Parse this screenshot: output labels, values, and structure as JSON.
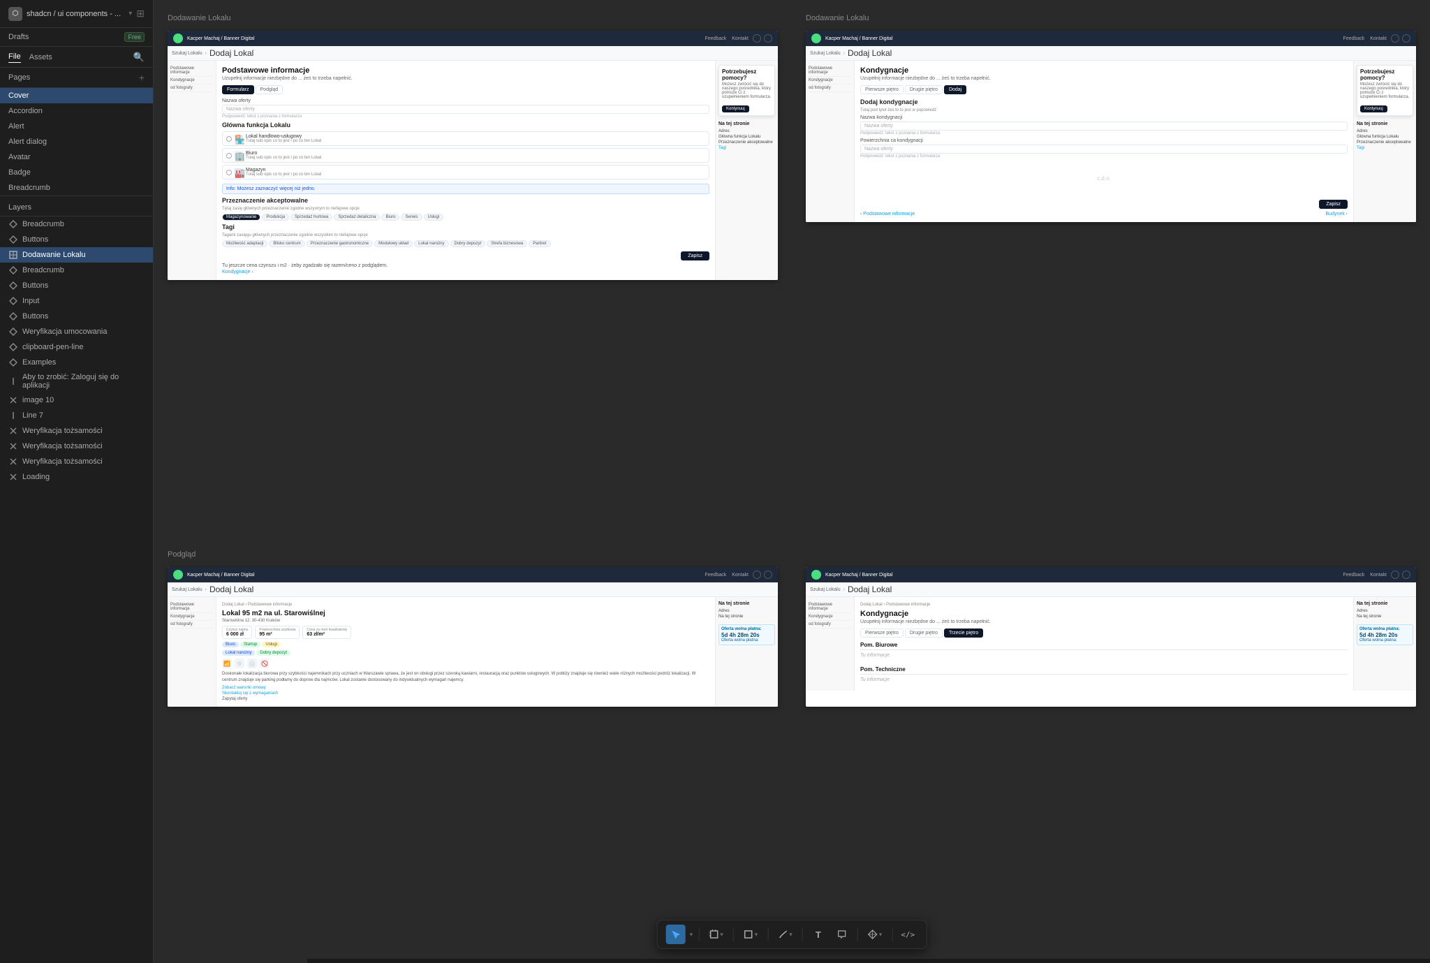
{
  "app": {
    "icon": "⬡",
    "title": "shadcn / ui components - ...",
    "layout_icon": "⊞"
  },
  "project": {
    "name": "shadcn / ui components - ...",
    "badge": "Free"
  },
  "file_tab": {
    "file": "File",
    "assets": "Assets"
  },
  "pages_label": "Pages",
  "sidebar_pages": [
    {
      "label": "Cover",
      "active": true
    },
    {
      "label": "Accordion"
    },
    {
      "label": "Alert"
    },
    {
      "label": "Alert dialog"
    },
    {
      "label": "Avatar"
    },
    {
      "label": "Badge"
    },
    {
      "label": "Breadcrumb"
    }
  ],
  "layers_label": "Layers",
  "layers": [
    {
      "label": "Breadcrumb",
      "icon": "diamond"
    },
    {
      "label": "Buttons",
      "icon": "diamond"
    },
    {
      "label": "Dodawanie Lokalu",
      "icon": "plus-cross",
      "selected": true
    },
    {
      "label": "Breadcrumb",
      "icon": "diamond"
    },
    {
      "label": "Buttons",
      "icon": "diamond"
    },
    {
      "label": "Input",
      "icon": "diamond"
    },
    {
      "label": "Buttons",
      "icon": "diamond"
    },
    {
      "label": "Weryfikacja umocowania",
      "icon": "diamond"
    },
    {
      "label": "clipboard-pen-line",
      "icon": "diamond"
    },
    {
      "label": "Examples",
      "icon": "diamond"
    },
    {
      "label": "Aby to zrobić:  Zaloguj się do aplikacji",
      "icon": "pipe"
    },
    {
      "label": "image 10",
      "icon": "cross"
    },
    {
      "label": "Line 7",
      "icon": "pipe"
    },
    {
      "label": "Weryfikacja tożsamości",
      "icon": "cross"
    },
    {
      "label": "Weryfikacja tożsamości",
      "icon": "cross"
    },
    {
      "label": "Weryfikacja tożsamości",
      "icon": "cross"
    },
    {
      "label": "Loading",
      "icon": "cross"
    }
  ],
  "sections": [
    {
      "title": "Dodawanie Lokalu"
    },
    {
      "title": "Dodawanie Lokalu"
    },
    {
      "title": "Podgląd"
    }
  ],
  "frame1": {
    "nav": {
      "logo_color": "#4ade80",
      "brand": "Kacper Machaj / Banner Digital",
      "links": [
        "Feedback",
        "Kontakt"
      ],
      "tab_active": "Dodaj Lokal"
    },
    "breadcrumb": [
      "Dodaj Lokal",
      "Podstawowe informacje"
    ],
    "left_nav": [
      "Podstawowe informacje",
      "Kondygnacje",
      "od fotografy"
    ],
    "form_title": "Podstawowe informacje",
    "form_subtitle": "Uzupełnij informacje niezbędne do ... żeś to trzeba napełnić.",
    "tabs": [
      "Formularz",
      "Podgląd"
    ],
    "field_name_label": "Nazwa oferty",
    "field_name_placeholder": "Nazwa oferty",
    "field_desc_placeholder": "Podpowiedź: tekst z poznania z formularzą",
    "main_function_label": "Główna funkcja Lokalu",
    "radio_items": [
      {
        "icon": "🏪",
        "title": "Lokal handlowo-usługowy",
        "sub": "Tutaj sub opis co to jest i po co ten Lokal"
      },
      {
        "icon": "🏢",
        "title": "Biuro",
        "sub": "Tutaj sub opis co to jest i po co ten Lokal"
      },
      {
        "icon": "🏭",
        "title": "Magazyn",
        "sub": "Tutaj sub opis co to jest i po co ten Lokal"
      }
    ],
    "info_text": "Info:  Możesz zaznaczyć więcej niż jedno.",
    "akceptowalne_label": "Przeznaczenie akceptowalne",
    "akceptowalne_sub": "Tętaj zasię głównych przeznaczenie zgodne wszystrym to niefajowe opcje",
    "tagi_label": "Tagi",
    "tagi_sub": "Tagami zasięgu głównych przeznaczenie zgodne wszystkim to niefajowe opcje",
    "przeznaczenie_tags": [
      "Magazynowanie",
      "Produkcja",
      "Sprzedaż hurtowa",
      "Sprzedaż detaliczna",
      "Biuro",
      "Serwis",
      "Usługi"
    ],
    "tagi_tags": [
      "Możliwość adaptacji",
      "Blisko centrum",
      "Przeznaczenie gastronomiczne",
      "Modułowy układ",
      "Lokal narożny",
      "Dobry depozyt",
      "Strefa biznesowa",
      "Partiret"
    ],
    "save_btn": "Zapisz",
    "next_label": "Kondygnacje",
    "help": {
      "title": "Potrzebujesz pomocy?",
      "text": "Możesz zwrócić się do naszego pośrednika, który pomoże Ci z uzupełnieniem formularza.",
      "btn": "Kontynuuj"
    },
    "right_panel": {
      "title": "Na tej stronie",
      "items": [
        "Adres",
        "Główna funkcja Lokalu",
        "Przeznaczenie akceptowalne",
        "Tagi"
      ]
    }
  },
  "frame2": {
    "nav": {
      "brand": "Kacper Machaj / Banner Digital",
      "links": [
        "Feedback",
        "Kontakt"
      ]
    },
    "breadcrumb": [
      "Dodaj Lokal",
      "Kondygnacje"
    ],
    "left_nav": [
      "Podstawowe informacje",
      "Kondygnacje",
      "od fotografy"
    ],
    "form_title": "Kondygnacje",
    "form_subtitle": "Uzupełnij informacje niezbędne do ... żeś to trzeba napełnić.",
    "page_tabs": [
      "Pierwsza piętro",
      "Drugie piętro",
      "Dodaj"
    ],
    "add_floor_title": "Dodaj kondygnacje",
    "add_floor_sub": "Tutaj pod tytuł żeś to to jest w popowiedź",
    "floor_name_label": "Nazwa kondygnacji",
    "floor_name_placeholder": "Nazwa oferty",
    "floor_desc_placeholder": "Podpowiedź: tekst z poznania z formularza",
    "floor_area_label": "Powierzchnia ca kondygnacji",
    "floor_area_placeholder": "Nazwa oferty",
    "floor_area_desc": "Podpowiedź: tekst z poznania z formularza",
    "cdt_text": "c.d.n.",
    "save_btn": "Zapisz",
    "prev_label": "Podstawowe informacje",
    "next_label": "Budynek",
    "help": {
      "title": "Potrzebujesz pomocy?",
      "text": "Możesz zwrócić się do naszego pośrednika, który pomoże Ci z uzupełnieniem formularza.",
      "btn": "Kontynuuj"
    },
    "right_panel": {
      "title": "Na tej stronie",
      "items": [
        "Adres",
        "Główna funkcja Lokalu",
        "Przeznaczenie akceptowalne",
        "Tagi"
      ]
    }
  },
  "frame3": {
    "nav": {
      "brand": "Kacper Machaj / Banner Digital",
      "links": [
        "Feedback",
        "Kontakt"
      ]
    },
    "breadcrumb": [
      "Dodaj Lokal",
      "Podstawowe informacje"
    ],
    "preview_title": "Lokal 95 m2 na ul. Starowiślnej",
    "preview_address": "Starowiślna 12, 30-430 Kraków",
    "stats": [
      {
        "label": "Czynsz najmu",
        "value": "6 000 zł"
      },
      {
        "label": "Powierzchnia użytkowa",
        "value": "95 m²"
      },
      {
        "label": "Cena za metr kwadratowy",
        "value": "63 zł/m²"
      }
    ],
    "preview_tags": [
      "Biuro",
      "Startup",
      "Usługi"
    ],
    "feature_tags": [
      "Lokal narożny",
      "Dobry depozyt"
    ],
    "description": "Doskonałe lokalizacja biurowa przy szybkości najemnikach przy uczniach w Warszawie sprawa, że jest on obsługi przez szeroką kawiarni, restauracją oraz punktów usługowych. W pobliży znajduje się również wiele różnych możliwości podróż lokalizacji. W centrum znajduje się parking podłamy do doprow dla najmców. Lokal zostanie dostosowany do indywidualnych wymagań najemcy.",
    "right_panel": {
      "title": "Na tej stronie",
      "items": [
        "Adres",
        "Na tej stronie",
        "Na tej stronie"
      ]
    },
    "timer": "5d 4h 28m 20s",
    "timer_label": "Oferta wolna płatna:",
    "left_nav": [
      "Podstawowe informacje",
      "Kondygnacje",
      "od fotografy"
    ]
  },
  "frame4": {
    "nav": {
      "brand": "Kacper Machaj / Banner Digital",
      "links": [
        "Feedback",
        "Kontakt"
      ]
    },
    "breadcrumb": [
      "Dodaj Lokal",
      "Podstawowe informacje"
    ],
    "form_title": "Kondygnacje",
    "form_subtitle": "Uzupełnij informacje niezbędne do ... żeś to trzeba napełnić.",
    "page_tabs": [
      "Pierwsza piętro",
      "Drugie piętro",
      "Trzecie piętro"
    ],
    "floor_sections": [
      "Pom. Biurowe",
      "Tu informacje",
      "Pom. Techniczne",
      "Tu informacje"
    ],
    "timer": "5d 4h 28m 20s",
    "timer_label": "Oferta wolna płatna:",
    "right_panel": {
      "title": "Na tej stronie",
      "items": [
        "Adres",
        "Na tej stronie"
      ]
    }
  },
  "toolbar": {
    "tools": [
      {
        "label": "▶",
        "active": true,
        "name": "select"
      },
      {
        "label": "⊞",
        "dropdown": true,
        "name": "frame"
      },
      {
        "label": "□",
        "dropdown": true,
        "name": "shape"
      },
      {
        "label": "⌒",
        "dropdown": true,
        "name": "pen"
      },
      {
        "label": "T",
        "name": "text"
      },
      {
        "label": "💬",
        "name": "comment"
      },
      {
        "label": "⁂",
        "dropdown": true,
        "name": "component"
      },
      {
        "label": "</>",
        "name": "code"
      }
    ]
  }
}
